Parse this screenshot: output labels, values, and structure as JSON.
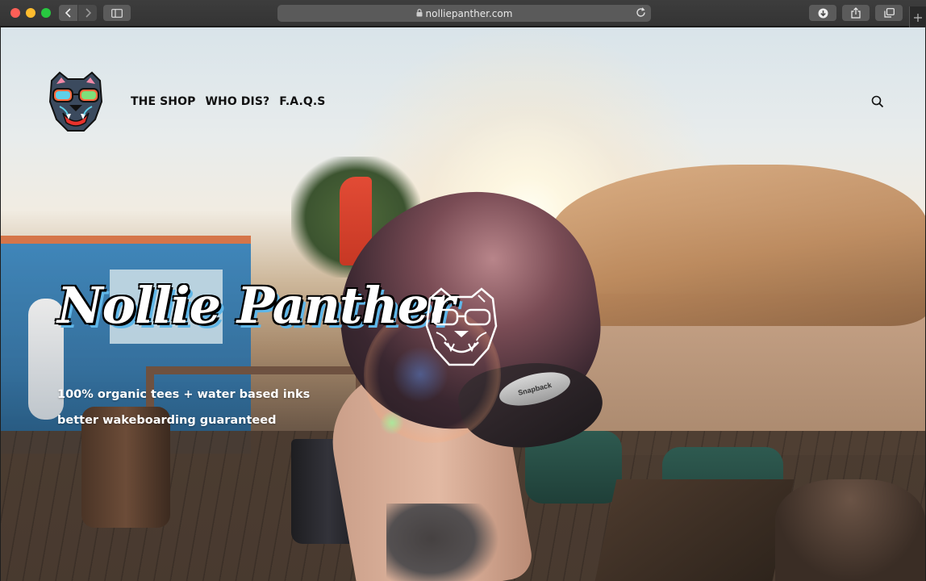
{
  "browser": {
    "url": "nolliepanther.com",
    "icons": {
      "back": "chevron-left-icon",
      "forward": "chevron-right-icon",
      "sidebar": "sidebar-icon",
      "lock": "lock-icon",
      "reload": "reload-icon",
      "download": "download-icon",
      "share": "share-icon",
      "tabs": "tabs-overview-icon",
      "new_tab": "plus-icon"
    }
  },
  "site": {
    "nav": [
      {
        "label": "THE SHOP"
      },
      {
        "label": "WHO DIS?"
      },
      {
        "label": "F.A.Q.S"
      }
    ],
    "search_icon": "search-icon"
  },
  "hero": {
    "wordmark": "Nollie Panther",
    "tagline_1": "100% organic tees + water based inks",
    "tagline_2": "better wakeboarding guaranteed",
    "cap_label": "Snapback"
  },
  "colors": {
    "nav_text": "#111111",
    "hero_text": "#ffffff",
    "wordmark_shadow": "#5fb6e8",
    "logo_panther": "#3b4a5e",
    "logo_glasses": "#ff6a3d"
  }
}
